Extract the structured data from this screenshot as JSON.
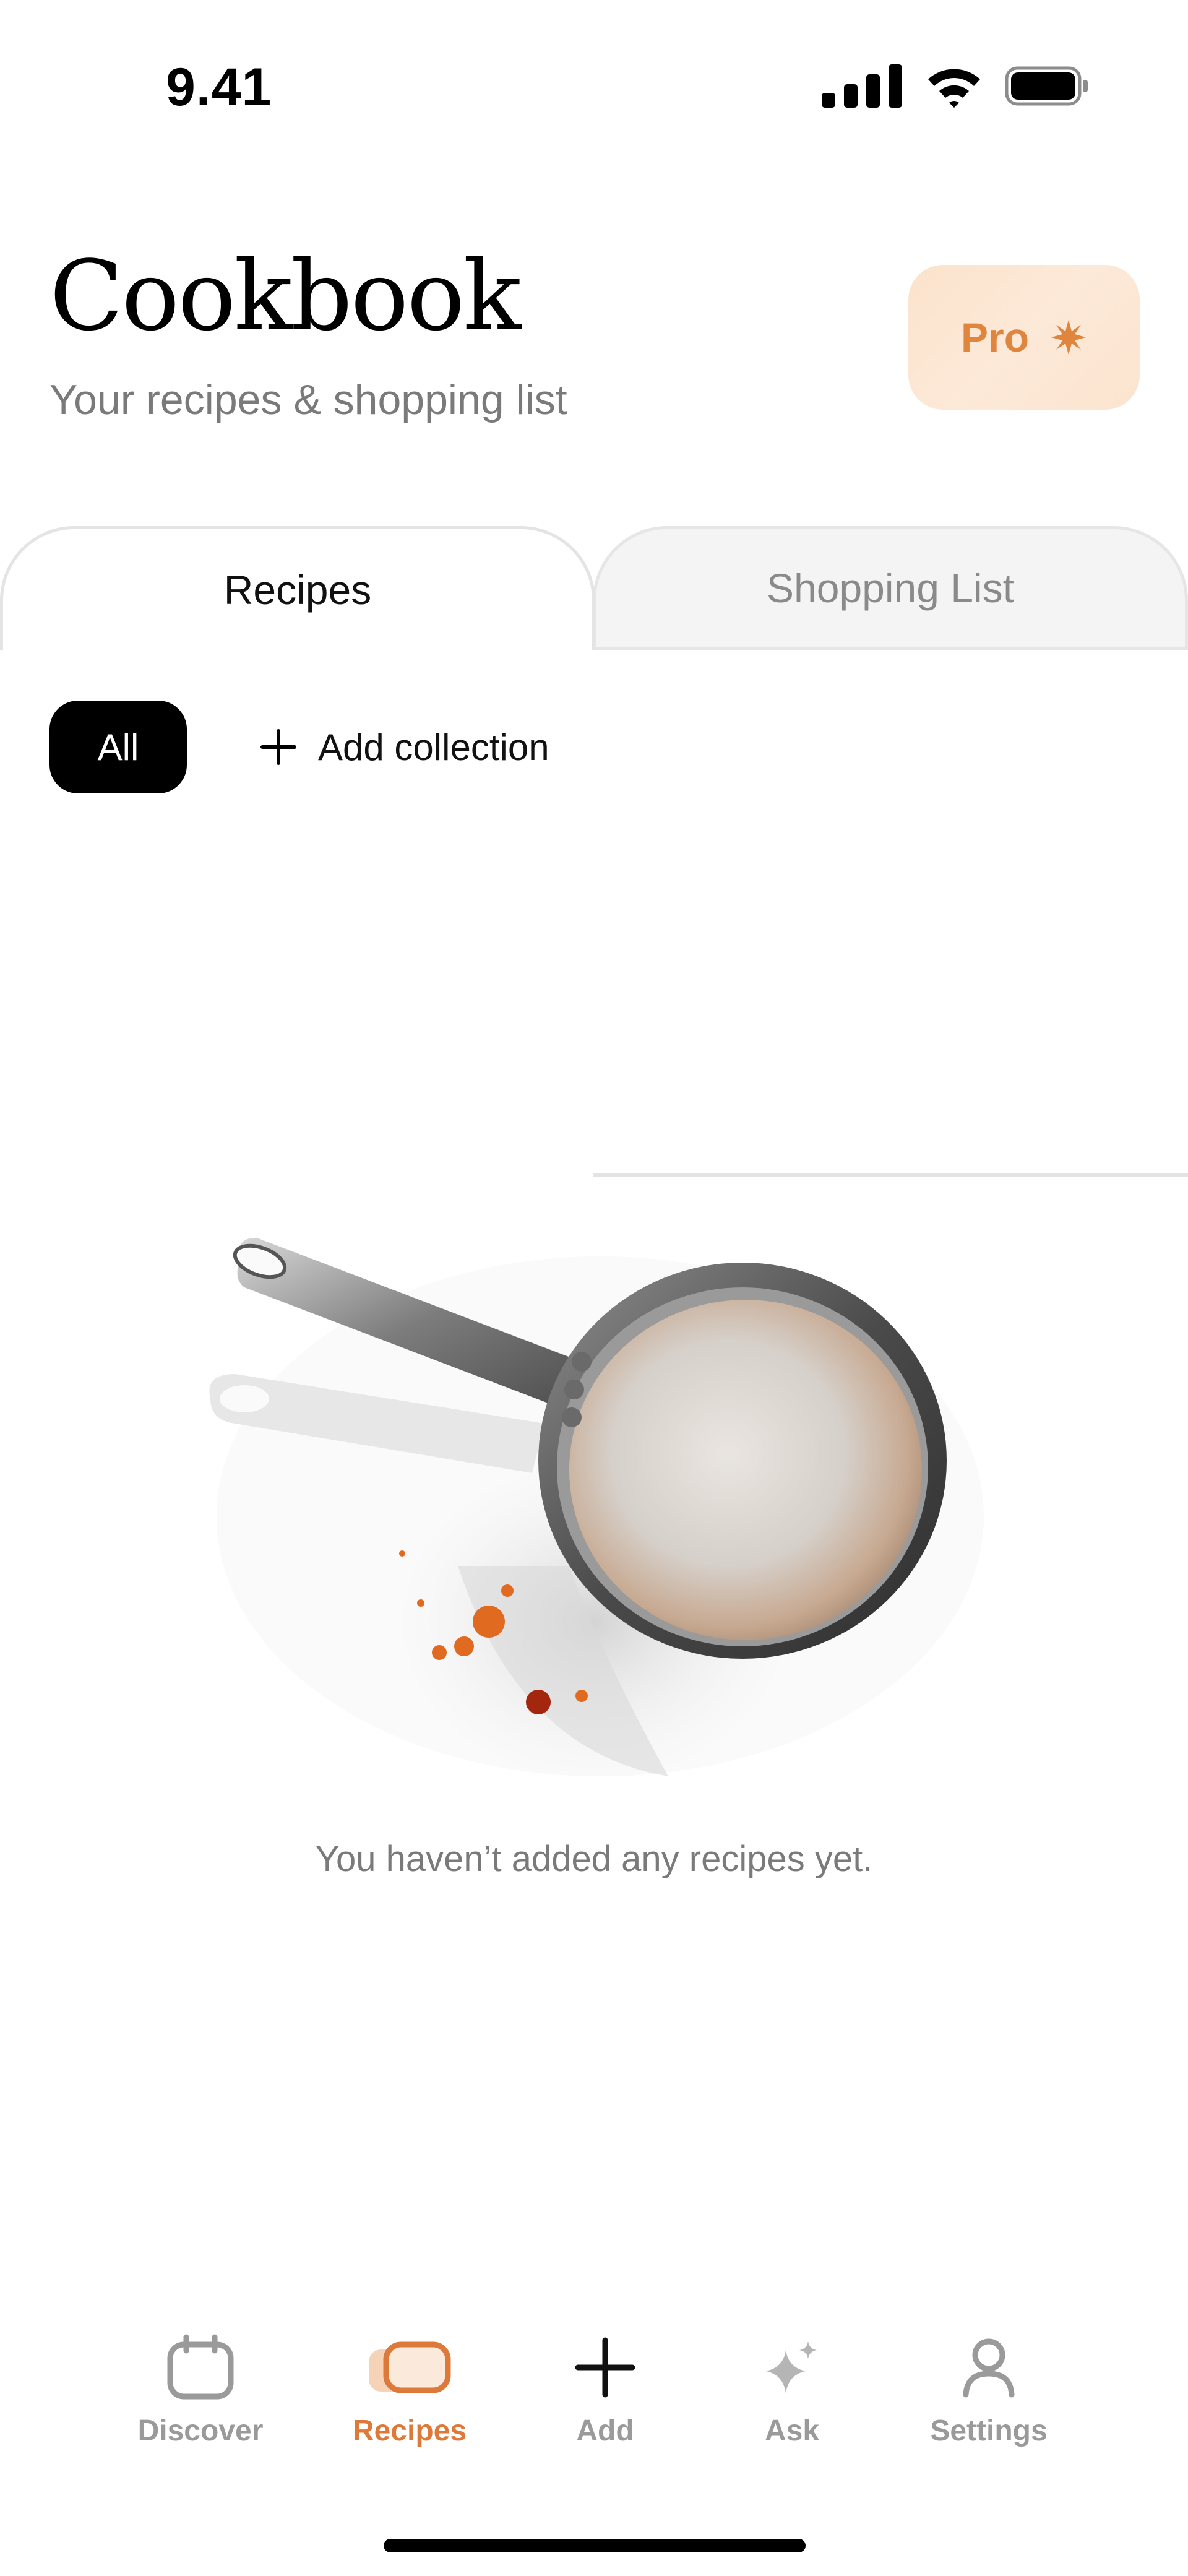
{
  "status_bar": {
    "time": "9.41"
  },
  "header": {
    "title": "Cookbook",
    "subtitle": "Your recipes & shopping list",
    "pro_label": "Pro",
    "pro_icon": "sparkle-burst-icon",
    "pro_color": "#e0853d"
  },
  "tabs": [
    {
      "label": "Recipes",
      "selected": true
    },
    {
      "label": "Shopping List",
      "selected": false
    }
  ],
  "filters": {
    "all_label": "All",
    "add_collection_label": "Add collection"
  },
  "empty_state": {
    "illustration": "frying-pan-illustration",
    "message": "You haven’t added any recipes yet."
  },
  "bottom_nav": {
    "items": [
      {
        "label": "Discover",
        "icon": "calendar-icon",
        "active": false
      },
      {
        "label": "Recipes",
        "icon": "recipe-card-icon",
        "active": true
      },
      {
        "label": "Add",
        "icon": "plus-icon",
        "active": false
      },
      {
        "label": "Ask",
        "icon": "sparkle-icon",
        "active": false
      },
      {
        "label": "Settings",
        "icon": "person-icon",
        "active": false
      }
    ],
    "active_color": "#dd7a3a",
    "inactive_color": "#9a9a9a"
  }
}
